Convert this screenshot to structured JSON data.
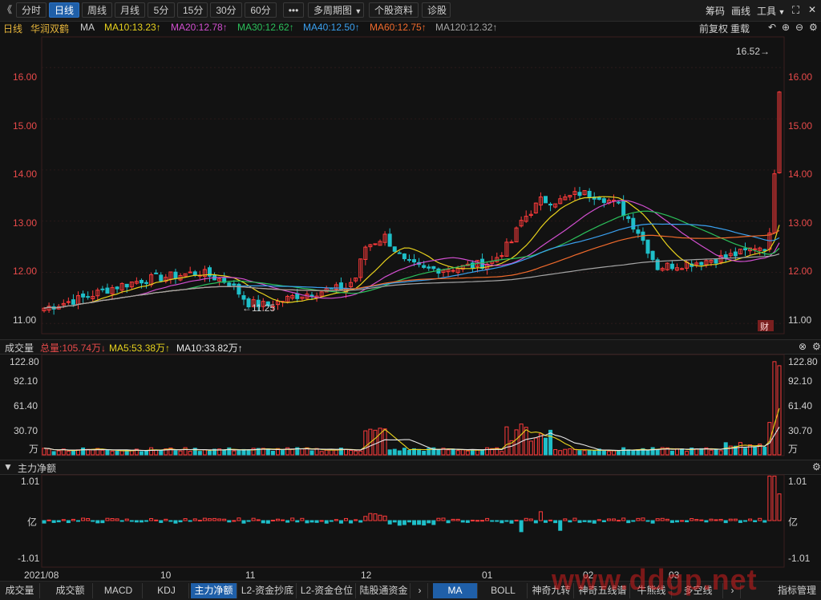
{
  "toolbar": {
    "back_icon": "double-chevron-left-icon",
    "back_glyph": "《",
    "periods": [
      "分时",
      "日线",
      "周线",
      "月线",
      "5分",
      "15分",
      "30分",
      "60分"
    ],
    "active_period": "日线",
    "more_glyph": "•••",
    "multi_period": "多周期图",
    "stock_info": "个股资料",
    "diagnose": "诊股",
    "chips": "筹码",
    "drawing": "画线",
    "tools": "工具",
    "fullscreen_glyph": "⛶",
    "close_glyph": "✕"
  },
  "infobar": {
    "period_label": "日线",
    "stock_name": "华润双鹤",
    "ma_label": "MA",
    "ma10": "MA10:13.23↑",
    "ma20": "MA20:12.78↑",
    "ma30": "MA30:12.62↑",
    "ma40": "MA40:12.50↑",
    "ma60": "MA60:12.75↑",
    "ma120": "MA120:12.32↑",
    "adjust": "前复权",
    "overlay": "重载",
    "colors": {
      "ma10": "#e8d21d",
      "ma20": "#d24fd0",
      "ma30": "#2bbf5a",
      "ma40": "#3aa0ef",
      "ma60": "#f06a2c",
      "ma120": "#a5a5a5"
    }
  },
  "price_axis": {
    "ticks": [
      "16.00",
      "15.00",
      "14.00",
      "13.00",
      "12.00",
      "11.00"
    ],
    "high_label": "16.52→",
    "low_label": "←11.25",
    "finance_badge": "财"
  },
  "volume_panel": {
    "title": "成交量",
    "total": "总量:105.74万↓",
    "ma5": "MA5:53.38万↑",
    "ma10": "MA10:33.82万↑",
    "ticks": [
      "122.80",
      "92.10",
      "61.40",
      "30.70"
    ],
    "unit": "万"
  },
  "flow_panel": {
    "title": "主力净额",
    "top": "1.01",
    "mid": "亿",
    "bottom": "-1.01"
  },
  "date_axis": [
    "2021/08",
    "10",
    "11",
    "12",
    "01",
    "02",
    "03"
  ],
  "bottom_tabs": [
    "成交量",
    "成交额",
    "MACD",
    "KDJ",
    "主力净额",
    "L2-资金抄底",
    "L2-资金仓位",
    "陆股通资金"
  ],
  "bottom_tabs_active": "主力净额",
  "bottom_tabs_right": [
    "MA",
    "BOLL",
    "神奇九转",
    "神奇五线谱",
    "牛熊线",
    "多空线"
  ],
  "bottom_tabs_right_active": "MA",
  "bottom_manage": "指标管理",
  "watermark": "www.ddgp.net",
  "chart_data": {
    "type": "candlestick",
    "price_ylim": [
      10.8,
      16.6
    ],
    "high": 16.52,
    "low": 11.25,
    "last_close_approx": 16.1,
    "volume_ylim": [
      0,
      122.8
    ],
    "volume_unit": "万",
    "flow_ylim": [
      -1.01,
      1.01
    ],
    "flow_unit": "亿",
    "months": [
      "2021/08",
      "10",
      "11",
      "12",
      "01",
      "02",
      "03"
    ]
  }
}
